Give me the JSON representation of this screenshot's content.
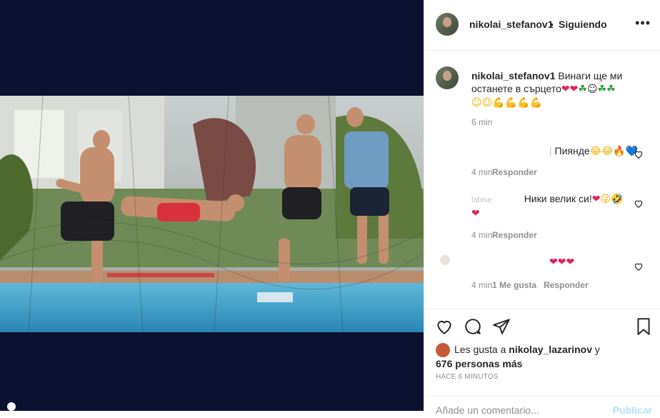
{
  "header": {
    "username": "nikolai_stefanov1",
    "separator": "•",
    "follow_status": "Siguiendo",
    "more": "•••"
  },
  "caption": {
    "username": "nikolai_stefanov1",
    "text": "Винаги ще ми останете в сърцето",
    "emojis": "❤❤☘☺☘☘ ☺☺💪💪💪💪",
    "time": "6 min"
  },
  "comments": [
    {
      "text": "Пиянде",
      "emojis": "😂😂🔥💙",
      "time": "4 min",
      "reply": "Responder"
    },
    {
      "text_partial": "labise.",
      "text": "Ники велик си!",
      "emojis": "❤😜🤣❤",
      "time": "4 min",
      "reply": "Responder"
    },
    {
      "emojis": "❤❤❤",
      "time": "4 min",
      "likes": "1 Me gusta",
      "reply": "Responder"
    }
  ],
  "likes": {
    "prefix": "Les gusta a",
    "user": "nikolay_lazarinov",
    "suffix": "y",
    "others": "676 personas más"
  },
  "timestamp": "HACE 6 MINUTOS",
  "add_comment": {
    "placeholder": "Añade un comentario...",
    "publish": "Publicar"
  },
  "colors": {
    "photo_bg": "#0b1230",
    "link_disabled": "#b2dffc",
    "meta_gray": "#8e8e8e"
  },
  "icons": [
    "heart-icon",
    "comment-icon",
    "share-icon",
    "bookmark-icon",
    "more-icon"
  ]
}
